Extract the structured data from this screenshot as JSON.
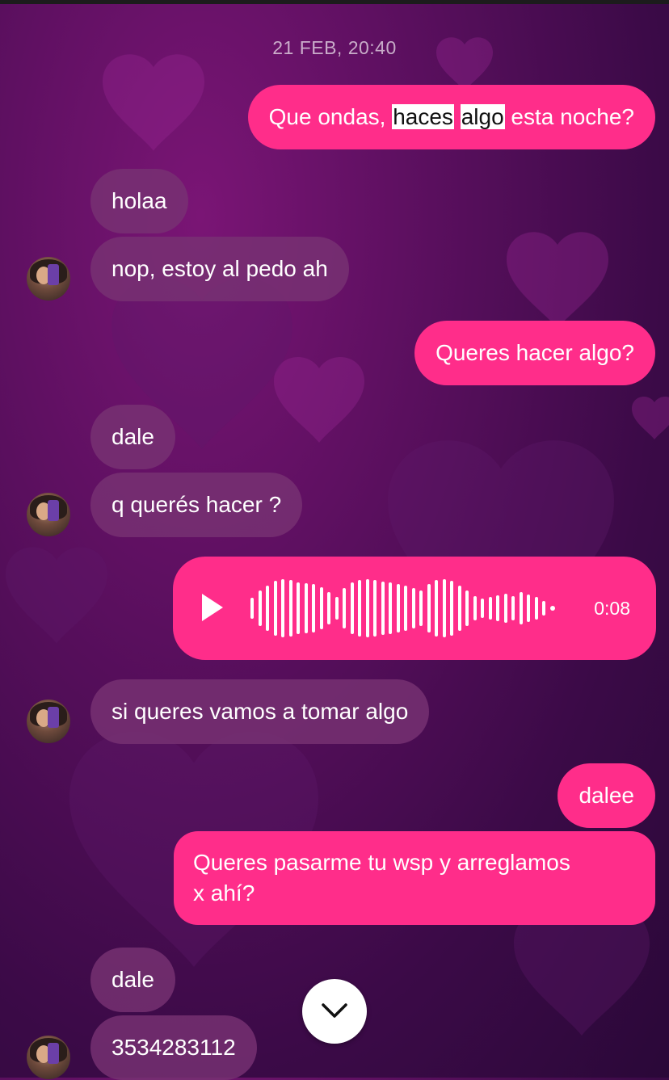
{
  "chat": {
    "timestamp": "21 FEB, 20:40",
    "messages": [
      {
        "from": "me",
        "segments": [
          "Que ondas, ",
          "haces",
          " ",
          "algo",
          " esta noche?"
        ],
        "highlighted": [
          "haces",
          "algo"
        ]
      },
      {
        "from": "them",
        "text": "holaa"
      },
      {
        "from": "them",
        "text": "nop, estoy al pedo ah"
      },
      {
        "from": "me",
        "text": "Queres hacer algo?"
      },
      {
        "from": "them",
        "text": "dale"
      },
      {
        "from": "them",
        "text": "q querés hacer ?"
      },
      {
        "from": "me",
        "type": "voice",
        "duration": "0:08"
      },
      {
        "from": "them",
        "text": "si queres vamos a tomar algo"
      },
      {
        "from": "me",
        "text": "dalee"
      },
      {
        "from": "me",
        "lines": [
          "Queres pasarme tu wsp y arreglamos",
          "x ahí?"
        ]
      },
      {
        "from": "them",
        "text": "dale"
      },
      {
        "from": "them",
        "text": "3534283112"
      }
    ]
  },
  "icons": {
    "play": "play-icon",
    "scroll_down": "chevron-down-icon",
    "avatar": "contact-avatar"
  },
  "colors": {
    "outgoing_bubble": "#ff2d8a",
    "incoming_bubble": "#78327380",
    "background": "#5a0f5e",
    "highlight": "#ffffff"
  }
}
